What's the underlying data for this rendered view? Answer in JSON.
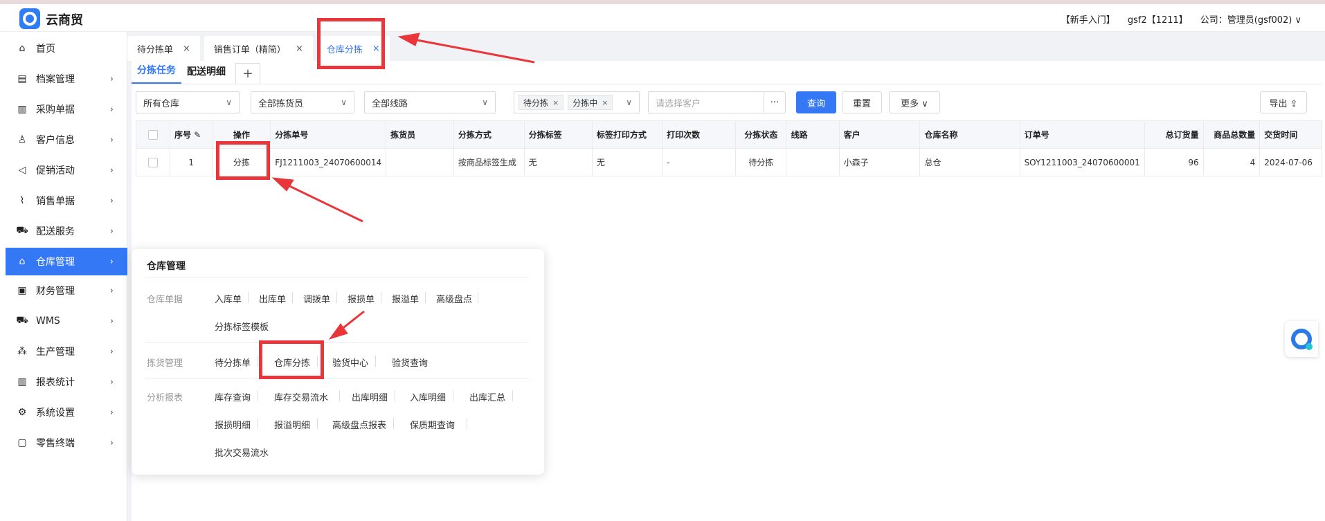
{
  "app": {
    "title": "云商贸"
  },
  "header": {
    "guide": "【新手入门】",
    "user": "gsf2【1211】",
    "company": "公司：管理员(gsf002) ∨"
  },
  "sidebar": {
    "items": [
      {
        "label": "首页",
        "icon": "home-icon",
        "glyph": "⌂"
      },
      {
        "label": "档案管理",
        "icon": "archive-icon",
        "glyph": "▤"
      },
      {
        "label": "采购单据",
        "icon": "purchase-doc-icon",
        "glyph": "▥"
      },
      {
        "label": "客户信息",
        "icon": "user-icon",
        "glyph": "♙"
      },
      {
        "label": "促销活动",
        "icon": "megaphone-icon",
        "glyph": "◁"
      },
      {
        "label": "销售单据",
        "icon": "chart-line-icon",
        "glyph": "⌇"
      },
      {
        "label": "配送服务",
        "icon": "cart-icon",
        "glyph": "⛟"
      },
      {
        "label": "仓库管理",
        "icon": "warehouse-icon",
        "glyph": "⌂"
      },
      {
        "label": "财务管理",
        "icon": "finance-icon",
        "glyph": "▣"
      },
      {
        "label": "WMS",
        "icon": "truck-icon",
        "glyph": "⛟"
      },
      {
        "label": "生产管理",
        "icon": "network-icon",
        "glyph": "⁂"
      },
      {
        "label": "报表统计",
        "icon": "bar-chart-icon",
        "glyph": "▥"
      },
      {
        "label": "系统设置",
        "icon": "gear-icon",
        "glyph": "⚙"
      },
      {
        "label": "零售终端",
        "icon": "bag-icon",
        "glyph": "▢"
      }
    ],
    "active_index": 7
  },
  "page_tabs": [
    {
      "label": "待分拣单",
      "close": "×"
    },
    {
      "label": "销售订单（精简）",
      "close": "×"
    },
    {
      "label": "仓库分拣",
      "close": "×"
    }
  ],
  "sub_tabs": [
    "分拣任务",
    "配送明细"
  ],
  "sub_tab_add": "+",
  "filters": {
    "warehouse": "所有仓库",
    "picker": "全部拣货员",
    "route": "全部线路",
    "status_tags": [
      "待分拣",
      "分拣中"
    ],
    "tag_close": "×",
    "customer_placeholder": "请选择客户",
    "more_dots": "···",
    "query": "查询",
    "reset": "重置",
    "more": "更多 ∨",
    "export": "导出 ⇪"
  },
  "table": {
    "headers": [
      "",
      "序号",
      "操作",
      "分拣单号",
      "拣货员",
      "分拣方式",
      "分拣标签",
      "标签打印方式",
      "打印次数",
      "分拣状态",
      "线路",
      "客户",
      "仓库名称",
      "订单号",
      "总订货量",
      "商品总数量",
      "交货时间"
    ],
    "seq_edit_icon": "✎",
    "rows": [
      {
        "seq": "1",
        "action": "分拣",
        "pick_no": "FJ1211003_24070600014",
        "picker": "",
        "method": "按商品标签生成",
        "label": "无",
        "print_mode": "无",
        "print_count": "-",
        "status": "待分拣",
        "route": "",
        "customer": "小森子",
        "warehouse": "总仓",
        "order_no": "SOY1211003_24070600001",
        "total_qty": "96",
        "goods_qty": "4",
        "delivery": "2024-07-06"
      }
    ]
  },
  "flyout": {
    "title": "仓库管理",
    "sections": [
      {
        "category": "仓库单据",
        "links": [
          "入库单",
          "出库单",
          "调拨单",
          "报损单",
          "报溢单",
          "高级盘点",
          "分拣标签模板"
        ]
      },
      {
        "category": "拣货管理",
        "links": [
          "待分拣单",
          "仓库分拣",
          "验货中心",
          "验货查询"
        ]
      },
      {
        "category": "分析报表",
        "links": [
          "库存查询",
          "库存交易流水",
          "出库明细",
          "入库明细",
          "出库汇总",
          "报损明细",
          "报溢明细",
          "高级盘点报表",
          "保质期查询",
          "批次交易流水"
        ]
      }
    ]
  },
  "colors": {
    "accent": "#3478f6",
    "annotation": "#e9363a",
    "sidebar_active": "#3478f6"
  }
}
